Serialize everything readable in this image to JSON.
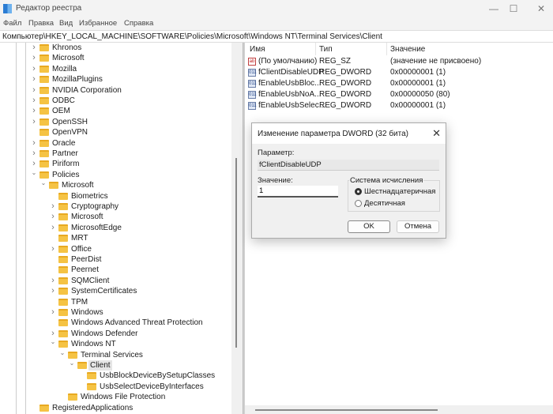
{
  "window": {
    "title": "Редактор реестра",
    "minimize": "—",
    "maximize": "☐",
    "close": "✕"
  },
  "menu": [
    "Файл",
    "Правка",
    "Вид",
    "Избранное",
    "Справка"
  ],
  "address": "Компьютер\\HKEY_LOCAL_MACHINE\\SOFTWARE\\Policies\\Microsoft\\Windows NT\\Terminal Services\\Client",
  "tree": [
    {
      "label": "Khronos",
      "level": 1,
      "exp": "collapsed"
    },
    {
      "label": "Microsoft",
      "level": 1,
      "exp": "collapsed"
    },
    {
      "label": "Mozilla",
      "level": 1,
      "exp": "collapsed"
    },
    {
      "label": "MozillaPlugins",
      "level": 1,
      "exp": "collapsed"
    },
    {
      "label": "NVIDIA Corporation",
      "level": 1,
      "exp": "collapsed"
    },
    {
      "label": "ODBC",
      "level": 1,
      "exp": "collapsed"
    },
    {
      "label": "OEM",
      "level": 1,
      "exp": "collapsed"
    },
    {
      "label": "OpenSSH",
      "level": 1,
      "exp": "collapsed"
    },
    {
      "label": "OpenVPN",
      "level": 1,
      "exp": "none"
    },
    {
      "label": "Oracle",
      "level": 1,
      "exp": "collapsed"
    },
    {
      "label": "Partner",
      "level": 1,
      "exp": "collapsed"
    },
    {
      "label": "Piriform",
      "level": 1,
      "exp": "collapsed"
    },
    {
      "label": "Policies",
      "level": 1,
      "exp": "expanded"
    },
    {
      "label": "Microsoft",
      "level": 2,
      "exp": "expanded"
    },
    {
      "label": "Biometrics",
      "level": 3,
      "exp": "none"
    },
    {
      "label": "Cryptography",
      "level": 3,
      "exp": "collapsed"
    },
    {
      "label": "Microsoft",
      "level": 3,
      "exp": "collapsed"
    },
    {
      "label": "MicrosoftEdge",
      "level": 3,
      "exp": "collapsed"
    },
    {
      "label": "MRT",
      "level": 3,
      "exp": "none"
    },
    {
      "label": "Office",
      "level": 3,
      "exp": "collapsed"
    },
    {
      "label": "PeerDist",
      "level": 3,
      "exp": "none"
    },
    {
      "label": "Peernet",
      "level": 3,
      "exp": "none"
    },
    {
      "label": "SQMClient",
      "level": 3,
      "exp": "collapsed"
    },
    {
      "label": "SystemCertificates",
      "level": 3,
      "exp": "collapsed"
    },
    {
      "label": "TPM",
      "level": 3,
      "exp": "none"
    },
    {
      "label": "Windows",
      "level": 3,
      "exp": "collapsed"
    },
    {
      "label": "Windows Advanced Threat Protection",
      "level": 3,
      "exp": "none"
    },
    {
      "label": "Windows Defender",
      "level": 3,
      "exp": "collapsed"
    },
    {
      "label": "Windows NT",
      "level": 3,
      "exp": "expanded"
    },
    {
      "label": "Terminal Services",
      "level": 4,
      "exp": "expanded"
    },
    {
      "label": "Client",
      "level": 5,
      "exp": "expanded",
      "selected": true
    },
    {
      "label": "UsbBlockDeviceBySetupClasses",
      "level": 6,
      "exp": "none"
    },
    {
      "label": "UsbSelectDeviceByInterfaces",
      "level": 6,
      "exp": "none"
    },
    {
      "label": "Windows File Protection",
      "level": 4,
      "exp": "none"
    },
    {
      "label": "RegisteredApplications",
      "level": 1,
      "exp": "none"
    }
  ],
  "list": {
    "columns": [
      "Имя",
      "Тип",
      "Значение"
    ],
    "rows": [
      {
        "icon": "ab",
        "name": "(По умолчанию)",
        "type": "REG_SZ",
        "value": "(значение не присвоено)"
      },
      {
        "icon": "011",
        "name": "fClientDisableUDP",
        "type": "REG_DWORD",
        "value": "0x00000001 (1)"
      },
      {
        "icon": "011",
        "name": "fEnableUsbBloc...",
        "type": "REG_DWORD",
        "value": "0x00000001 (1)"
      },
      {
        "icon": "011",
        "name": "fEnableUsbNoA...",
        "type": "REG_DWORD",
        "value": "0x00000050 (80)"
      },
      {
        "icon": "011",
        "name": "fEnableUsbSelec...",
        "type": "REG_DWORD",
        "value": "0x00000001 (1)"
      }
    ]
  },
  "dialog": {
    "title": "Изменение параметра DWORD (32 бита)",
    "close": "✕",
    "param_label": "Параметр:",
    "param_value": "fClientDisableUDP",
    "value_label": "Значение:",
    "value": "1",
    "base_label": "Система исчисления",
    "hex": "Шестнадцатеричная",
    "dec": "Десятичная",
    "selected_base": "hex",
    "ok": "OK",
    "cancel": "Отмена"
  }
}
